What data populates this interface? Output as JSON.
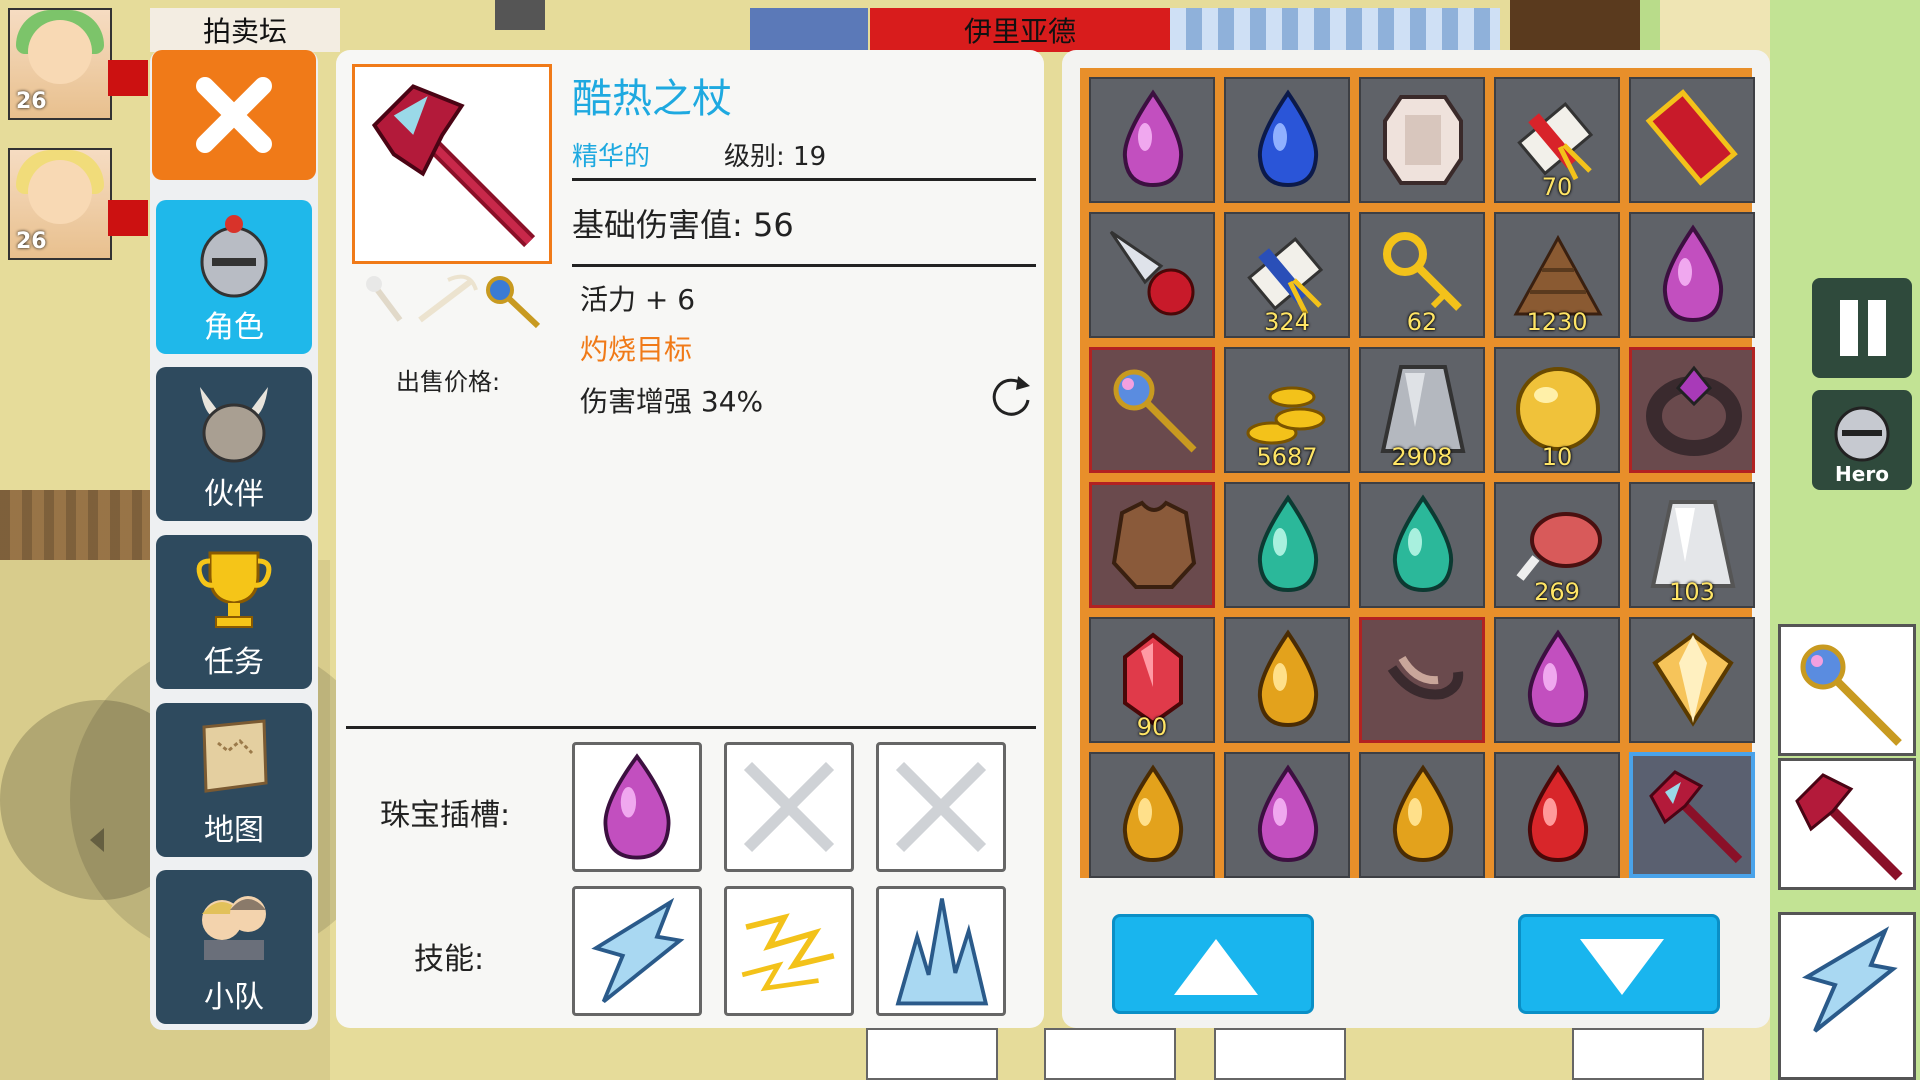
{
  "world": {
    "forum_sign": "拍卖坛",
    "area_name": "伊里亚德",
    "party": [
      {
        "level": "26"
      },
      {
        "level": "26"
      }
    ]
  },
  "nav": {
    "items": [
      {
        "label": "角色",
        "icon": "knight-helmet-icon",
        "active": true
      },
      {
        "label": "伙伴",
        "icon": "horned-helmet-icon",
        "active": false
      },
      {
        "label": "任务",
        "icon": "trophy-icon",
        "active": false
      },
      {
        "label": "地图",
        "icon": "map-scroll-icon",
        "active": false
      },
      {
        "label": "小队",
        "icon": "team-icon",
        "active": false
      }
    ]
  },
  "item": {
    "name": "酷热之杖",
    "quality": "精华的",
    "level_text": "级别: 19",
    "base_damage": "基础伤害值: 56",
    "stats": [
      {
        "text": "活力 + 6",
        "highlight": false
      },
      {
        "text": "灼烧目标",
        "highlight": true
      },
      {
        "text": "伤害增强 34%",
        "highlight": false
      }
    ],
    "sell_price_label": "出售价格:",
    "socket_label": "珠宝插槽:",
    "skill_label": "技能:",
    "sockets": [
      "purple-gem-icon",
      "empty-socket-icon",
      "empty-socket-icon"
    ],
    "skills": [
      "ice-shard-skill-icon",
      "lightning-skill-icon",
      "ice-spike-skill-icon"
    ]
  },
  "inventory": {
    "cells": [
      {
        "icon": "purple-gem-icon",
        "count": "",
        "rare": false
      },
      {
        "icon": "blue-gem-icon",
        "count": "",
        "rare": false
      },
      {
        "icon": "diamond-icon",
        "count": "",
        "rare": false
      },
      {
        "icon": "red-scroll-icon",
        "count": "70",
        "rare": false
      },
      {
        "icon": "red-ruby-icon",
        "count": "",
        "rare": false
      },
      {
        "icon": "drill-icon",
        "count": "",
        "rare": false
      },
      {
        "icon": "blue-scroll-icon",
        "count": "324",
        "rare": false
      },
      {
        "icon": "key-icon",
        "count": "62",
        "rare": false
      },
      {
        "icon": "wood-pile-icon",
        "count": "1230",
        "rare": false
      },
      {
        "icon": "purple-gem-icon",
        "count": "",
        "rare": false
      },
      {
        "icon": "orb-staff-icon",
        "count": "",
        "rare": true
      },
      {
        "icon": "gold-coins-icon",
        "count": "5687",
        "rare": false
      },
      {
        "icon": "iron-ingot-icon",
        "count": "2908",
        "rare": false
      },
      {
        "icon": "gold-orb-icon",
        "count": "10",
        "rare": false
      },
      {
        "icon": "dark-ring-icon",
        "count": "",
        "rare": true
      },
      {
        "icon": "leather-armor-icon",
        "count": "",
        "rare": true
      },
      {
        "icon": "teal-gem-icon",
        "count": "",
        "rare": false
      },
      {
        "icon": "teal-gem-icon",
        "count": "",
        "rare": false
      },
      {
        "icon": "meat-icon",
        "count": "269",
        "rare": false
      },
      {
        "icon": "silver-ingot-icon",
        "count": "103",
        "rare": false
      },
      {
        "icon": "red-crystal-icon",
        "count": "90",
        "rare": false
      },
      {
        "icon": "amber-gem-icon",
        "count": "",
        "rare": false
      },
      {
        "icon": "boots-icon",
        "count": "",
        "rare": true
      },
      {
        "icon": "purple-gem-icon",
        "count": "",
        "rare": false
      },
      {
        "icon": "gold-diamond-icon",
        "count": "",
        "rare": false
      },
      {
        "icon": "amber-gem-icon",
        "count": "",
        "rare": false
      },
      {
        "icon": "purple-gem-icon",
        "count": "",
        "rare": false
      },
      {
        "icon": "amber-gem-icon",
        "count": "",
        "rare": false
      },
      {
        "icon": "red-gem-icon",
        "count": "",
        "rare": false
      },
      {
        "icon": "crimson-staff-icon",
        "count": "",
        "rare": false,
        "selected": true
      }
    ]
  },
  "hud": {
    "hero_label": "Hero"
  },
  "colors": {
    "accent_orange": "#f07a18",
    "accent_blue": "#1ea9e0",
    "nav_active": "#1fb8ea",
    "nav_inactive": "#2e4a5e"
  }
}
